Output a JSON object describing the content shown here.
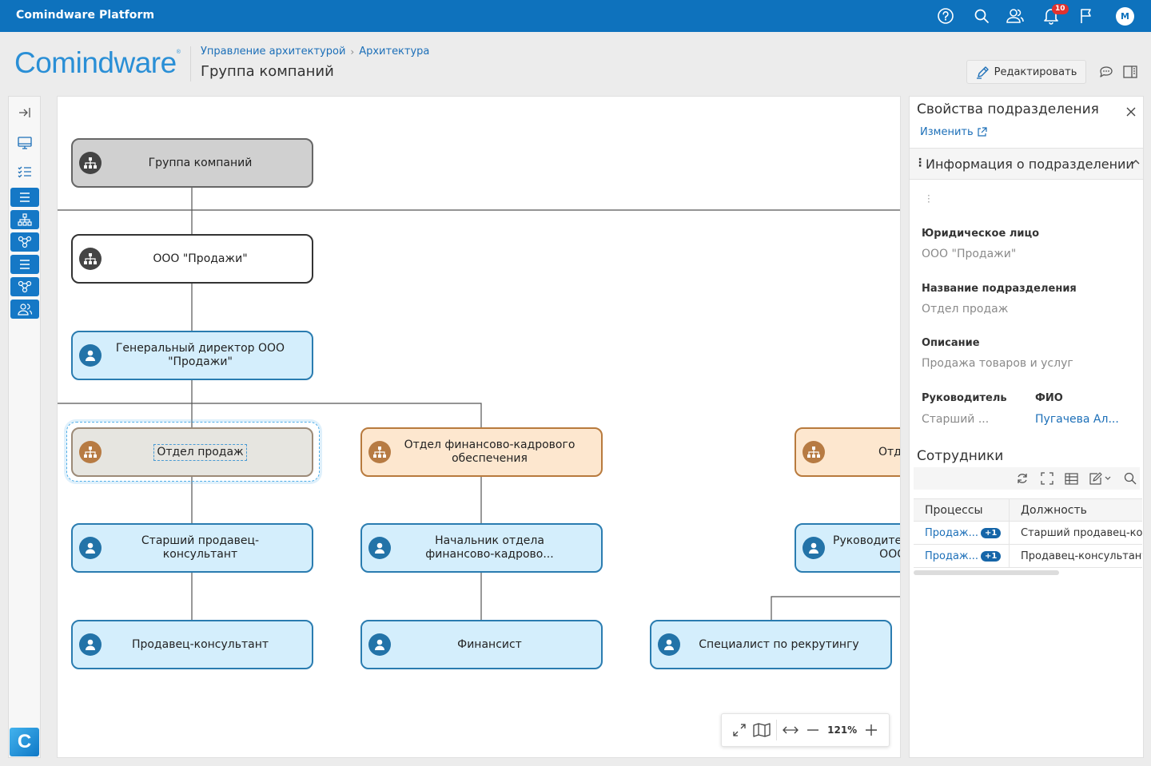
{
  "topbar": {
    "app_title": "Comindware Platform",
    "notifications_count": "10",
    "avatar_initial": "M"
  },
  "header": {
    "logo": "Comindware",
    "breadcrumbs": [
      "Управление архитектурой",
      "Архитектура"
    ],
    "title": "Группа компаний",
    "edit_label": "Редактировать"
  },
  "diagram": {
    "nodes": {
      "group": "Группа компаний",
      "llc": "ООО \"Продажи\"",
      "ceo": "Генеральный директор ООО \"Продажи\"",
      "sales_dept": "Отдел продаж",
      "finance_dept": "Отдел финансово-кадрового обеспечения",
      "third_dept": "Отд",
      "senior_consultant": "Старший продавец-консультант",
      "finance_head": "Начальник отдела финансово-кадрово...",
      "third_head": "Руководител ООС",
      "consultant": "Продавец-консультант",
      "financier": "Финансист",
      "recruiter": "Специалист по рекрутингу"
    },
    "zoom": "121%"
  },
  "panel": {
    "title": "Свойства подразделения",
    "change_label": "Изменить",
    "section_title": "Информация о подразделении",
    "fields": {
      "legal_entity_label": "Юридическое лицо",
      "legal_entity_value": "ООО \"Продажи\"",
      "name_label": "Название подразделения",
      "name_value": "Отдел продаж",
      "desc_label": "Описание",
      "desc_value": "Продажа товаров и услуг",
      "head_label": "Руководитель",
      "head_value": "Старший ...",
      "fio_label": "ФИО",
      "fio_value": "Пугачева Ал..."
    },
    "employees": {
      "title": "Сотрудники",
      "columns": [
        "Процессы",
        "Должность"
      ],
      "rows": [
        {
          "process": "Продаж...",
          "more": "+1",
          "position": "Старший продавец-кон"
        },
        {
          "process": "Продаж...",
          "more": "+1",
          "position": "Продавец-консультант"
        }
      ]
    }
  }
}
